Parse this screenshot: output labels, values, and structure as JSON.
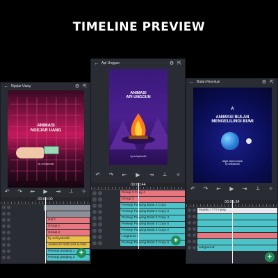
{
  "headline": "TIMELINE PREVIEW",
  "phones": {
    "left": {
      "title": "Ngejar Uang",
      "art_title": "ANIMASI\nNGEJAR UANG",
      "art_credit": "by ochiyskodki",
      "time": "00:00:00",
      "layers": [
        "Hal 1",
        "Group 1",
        "Group 2",
        "by achiyskodki",
        "ANIMASI NGEJAR UANG",
        "Persegi panjang 1",
        "Persegi panjang 2"
      ]
    },
    "center": {
      "title": "Api Unggun",
      "art_title": "ANIMASI\nAPI UNGGUN",
      "art_credit": "by achiyskodki",
      "time": "00:00:44",
      "layers": [
        "Group 3 Copy 4",
        "Group 3",
        "Persegi Panjang Bulat 2 Copy",
        "Persegi Panjang Bulat 2 Copy 3",
        "Persegi Panjang Bulat 2 Copy 4",
        "Persegi Panjang Bulat 2 Copy 5",
        "Persegi Panjang Bulat 2 Copy 2",
        "Lingkaran 1",
        "Persegi Panjang Bulat 2 Copy 6"
      ]
    },
    "right": {
      "title": "Bulan Revolusi",
      "art_logo": "A",
      "art_title": "ANIMASI BULAN\nMENGELILINGI BUMI",
      "art_credit": "Alight motion tutorial\nby achiyskodki",
      "time": "00:01:34",
      "layers": [
        "mundo / ??? / png",
        "",
        "",
        "",
        "",
        "",
        "ackground"
      ]
    }
  },
  "colors": {
    "fab": "#1e8e58",
    "bar_pink": "#e8767e",
    "bar_cyan": "#4cc3c8",
    "bar_yellow": "#e8c04a",
    "bar_grey": "#8b8f97"
  }
}
